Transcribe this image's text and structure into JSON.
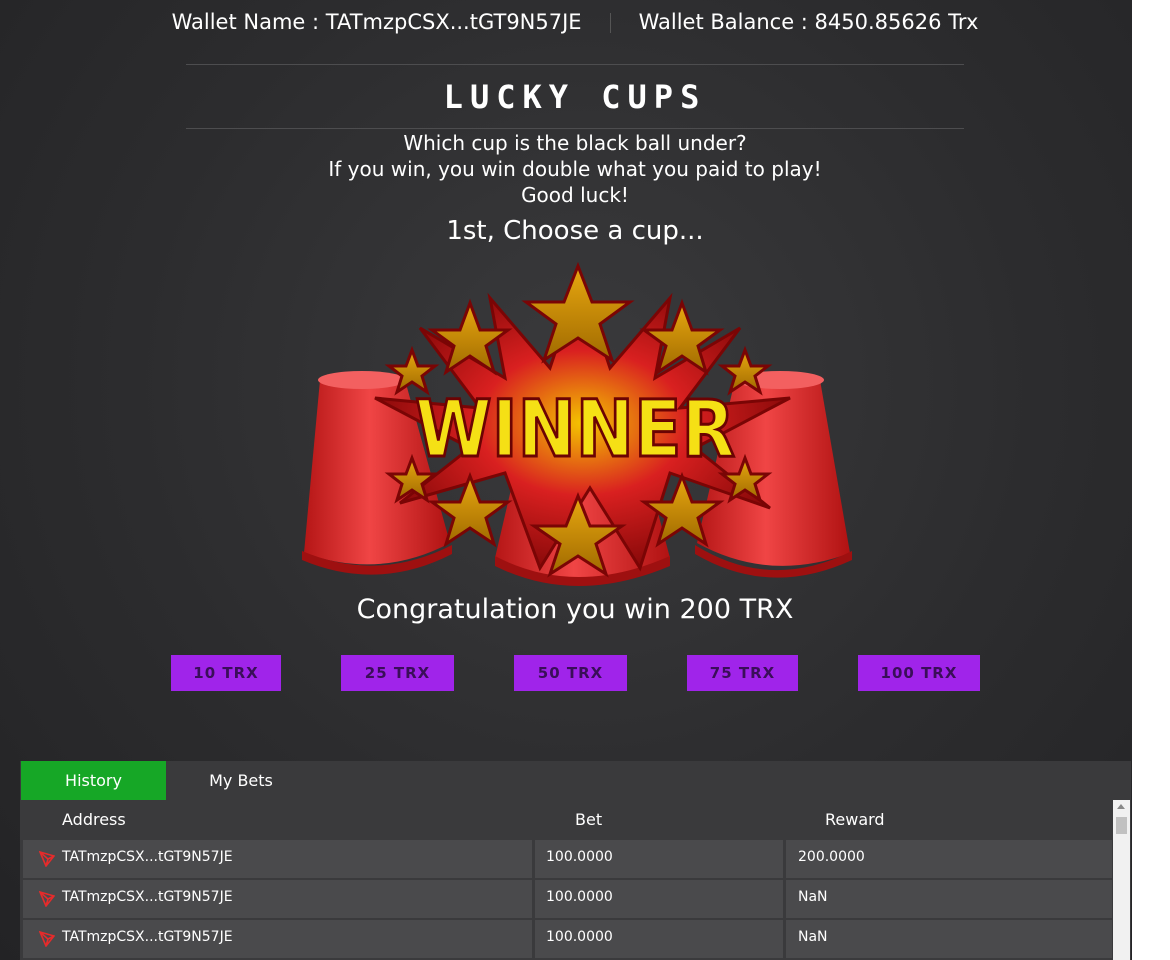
{
  "header": {
    "wallet_name_label": "Wallet Name : TATmzpCSX...tGT9N57JE",
    "wallet_balance_label": "Wallet Balance : 8450.85626 Trx"
  },
  "game": {
    "title": "LUCKY CUPS",
    "instructions": [
      "Which cup is the black ball under?",
      "If you win, you win double what you paid to play!",
      "Good luck!"
    ],
    "step": "1st, Choose a cup...",
    "banner_text": "WINNER",
    "result": "Congratulation you win 200 TRX"
  },
  "bets": [
    "10 TRX",
    "25 TRX",
    "50 TRX",
    "75 TRX",
    "100 TRX"
  ],
  "tabs": [
    "History",
    "My Bets"
  ],
  "table": {
    "columns": [
      "Address",
      "Bet",
      "Reward"
    ],
    "rows": [
      {
        "address": "TATmzpCSX...tGT9N57JE",
        "bet": "100.0000",
        "reward": "200.0000"
      },
      {
        "address": "TATmzpCSX...tGT9N57JE",
        "bet": "100.0000",
        "reward": "NaN"
      },
      {
        "address": "TATmzpCSX...tGT9N57JE",
        "bet": "100.0000",
        "reward": "NaN"
      }
    ]
  },
  "colors": {
    "accent_purple": "#a024ea",
    "tab_active": "#16a726",
    "cup_red": "#e02b2b",
    "banner_yellow": "#f5e015"
  }
}
